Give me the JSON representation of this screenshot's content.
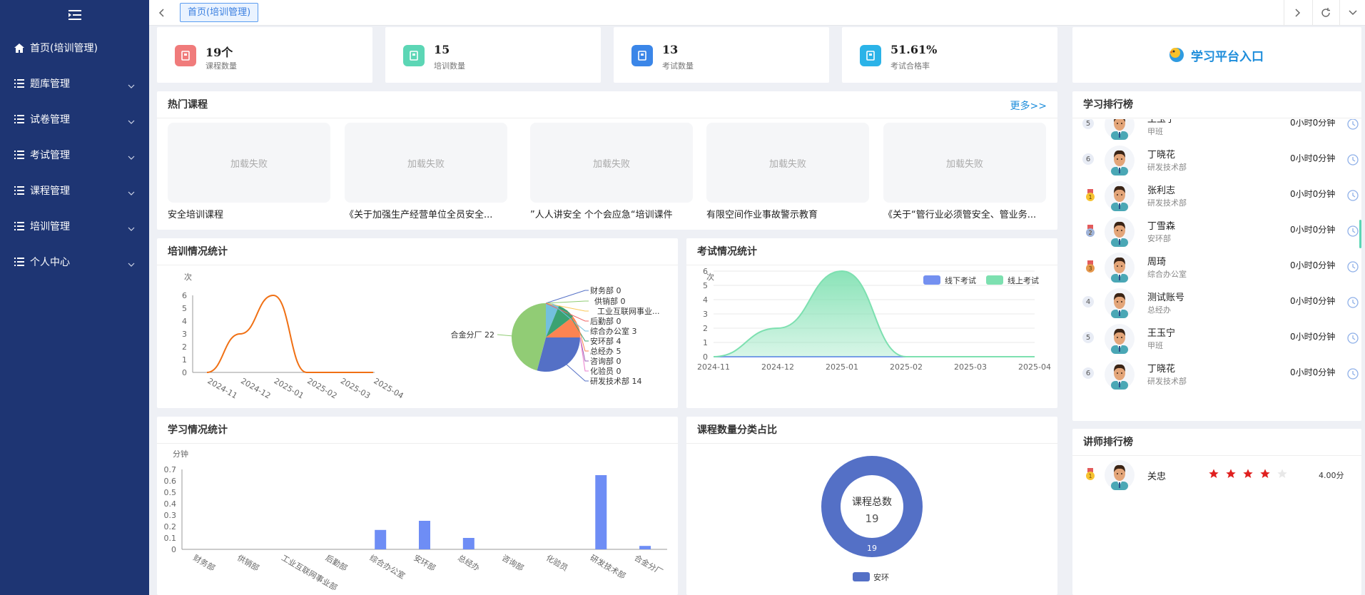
{
  "sidebar": {
    "items": [
      {
        "label": "首页(培训管理)",
        "icon": "home-icon"
      },
      {
        "label": "题库管理",
        "icon": "list-icon"
      },
      {
        "label": "试卷管理",
        "icon": "list-icon"
      },
      {
        "label": "考试管理",
        "icon": "list-icon"
      },
      {
        "label": "课程管理",
        "icon": "list-icon"
      },
      {
        "label": "培训管理",
        "icon": "list-icon"
      },
      {
        "label": "个人中心",
        "icon": "list-icon"
      }
    ]
  },
  "tabs": {
    "active": "首页(培训管理)"
  },
  "stats": [
    {
      "value": "19个",
      "label": "课程数量",
      "color": "#f07b7b"
    },
    {
      "value": "15",
      "label": "培训数量",
      "color": "#5cd6b5"
    },
    {
      "value": "13",
      "label": "考试数量",
      "color": "#3b86e8"
    },
    {
      "value": "51.61%",
      "label": "考试合格率",
      "color": "#2bb3e8"
    }
  ],
  "entry": {
    "label": "学习平台入口"
  },
  "hot": {
    "title": "热门课程",
    "more": "更多>>",
    "placeholder": "加载失败",
    "courses": [
      "安全培训课程",
      "《关于加强生产经营单位全员安全...",
      "”人人讲安全 个个会应急“培训课件",
      "有限空间作业事故警示教育",
      "《关于“管行业必须管安全、管业务..."
    ]
  },
  "training": {
    "title": "培训情况统计",
    "unit": "次"
  },
  "exam": {
    "title": "考试情况统计",
    "unit": "次"
  },
  "study": {
    "title": "学习情况统计",
    "unit": "分钟"
  },
  "course_cat": {
    "title": "课程数量分类占比",
    "center_label": "课程总数",
    "center_value": "19",
    "slice_label": "19",
    "legend": "安环"
  },
  "rank": {
    "title": "学习排行榜",
    "rows": [
      {
        "badge": "5",
        "name": "王玉宁",
        "dept": "甲班",
        "time": "0小时0分钟"
      },
      {
        "badge": "6",
        "name": "丁晓花",
        "dept": "研发技术部",
        "time": "0小时0分钟"
      },
      {
        "badge": "1",
        "name": "张利志",
        "dept": "研发技术部",
        "time": "0小时0分钟"
      },
      {
        "badge": "2",
        "name": "丁雪森",
        "dept": "安环部",
        "time": "0小时0分钟"
      },
      {
        "badge": "3",
        "name": "周琦",
        "dept": "综合办公室",
        "time": "0小时0分钟"
      },
      {
        "badge": "4",
        "name": "测试账号",
        "dept": "总经办",
        "time": "0小时0分钟"
      },
      {
        "badge": "5",
        "name": "王玉宁",
        "dept": "甲班",
        "time": "0小时0分钟"
      },
      {
        "badge": "6",
        "name": "丁晓花",
        "dept": "研发技术部",
        "time": "0小时0分钟"
      }
    ]
  },
  "teacher": {
    "title": "讲师排行榜",
    "name": "关忠",
    "score": "4.00分",
    "stars": 4,
    "max_stars": 5
  },
  "chart_data": [
    {
      "type": "line",
      "title": "培训情况统计",
      "ylabel": "次",
      "x": [
        "2024-11",
        "2024-12",
        "2025-01",
        "2025-02",
        "2025-03",
        "2025-04"
      ],
      "values": [
        0,
        3,
        6,
        0,
        0,
        0
      ],
      "yticks": [
        0,
        1,
        2,
        3,
        4,
        5,
        6
      ],
      "ylim": [
        0,
        6
      ],
      "color": "#f07014"
    },
    {
      "type": "pie",
      "title": "培训情况统计",
      "slices": [
        {
          "label": "财务部",
          "value": 0,
          "color": "#5470c6"
        },
        {
          "label": "供销部",
          "value": 0,
          "color": "#91cc75"
        },
        {
          "label": "工业互联网事业...",
          "value": 0,
          "color": "#fac858"
        },
        {
          "label": "后勤部",
          "value": 0,
          "color": "#ee6666"
        },
        {
          "label": "综合办公室",
          "value": 3,
          "color": "#73c0de"
        },
        {
          "label": "安环部",
          "value": 4,
          "color": "#3ba272"
        },
        {
          "label": "总经办",
          "value": 5,
          "color": "#fc8452"
        },
        {
          "label": "咨询部",
          "value": 0,
          "color": "#9a60b4"
        },
        {
          "label": "化验员",
          "value": 0,
          "color": "#ea7ccc"
        },
        {
          "label": "研发技术部",
          "value": 14,
          "color": "#5470c6"
        },
        {
          "label": "合金分厂",
          "value": 22,
          "color": "#91cc75"
        }
      ]
    },
    {
      "type": "area",
      "title": "考试情况统计",
      "ylabel": "次",
      "x": [
        "2024-11",
        "2024-12",
        "2025-01",
        "2025-02",
        "2025-03",
        "2025-04"
      ],
      "yticks": [
        0,
        1,
        2,
        3,
        4,
        5,
        6
      ],
      "ylim": [
        0,
        6
      ],
      "legend": "top-right",
      "grid": true,
      "series": [
        {
          "name": "线下考试",
          "values": [
            0,
            0,
            0,
            0,
            0,
            0
          ],
          "color": "#7490f0"
        },
        {
          "name": "线上考试",
          "values": [
            0,
            2,
            6,
            0,
            0,
            0
          ],
          "color": "#7de0b0"
        }
      ]
    },
    {
      "type": "bar",
      "title": "学习情况统计",
      "ylabel": "分钟",
      "categories": [
        "财务部",
        "供销部",
        "工业互联网事业部",
        "后勤部",
        "综合办公室",
        "安环部",
        "总经办",
        "咨询部",
        "化验员",
        "研发技术部",
        "合金分厂"
      ],
      "values": [
        0,
        0,
        0,
        0,
        0.17,
        0.25,
        0.1,
        0,
        0,
        0.65,
        0.03
      ],
      "yticks": [
        0,
        0.1,
        0.2,
        0.3,
        0.4,
        0.5,
        0.6,
        0.7
      ],
      "ylim": [
        0,
        0.7
      ],
      "color": "#6e8df5"
    },
    {
      "type": "pie",
      "title": "课程数量分类占比",
      "slices": [
        {
          "label": "安环",
          "value": 19,
          "color": "#5470c6"
        }
      ]
    }
  ]
}
